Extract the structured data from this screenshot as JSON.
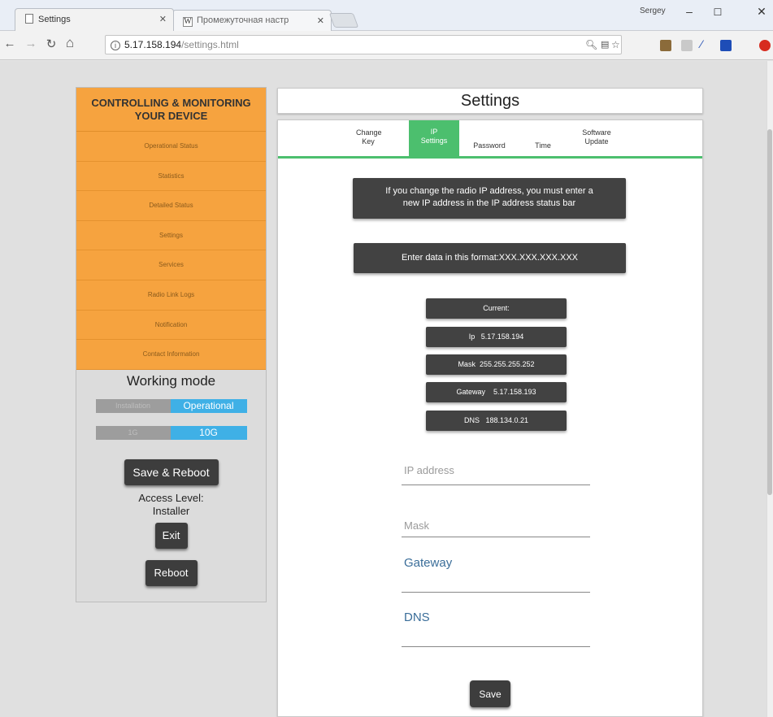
{
  "browser": {
    "tabs": [
      {
        "label": "Settings"
      },
      {
        "label": "Промежуточная настр"
      }
    ],
    "user": "Sergey",
    "url_host": "5.17.158.194",
    "url_path": "/settings.html"
  },
  "sidebar": {
    "header_line1": "CONTROLLING & MONITORING",
    "header_line2": "YOUR DEVICE",
    "items": [
      {
        "label": "Operational Status"
      },
      {
        "label": "Statistics"
      },
      {
        "label": "Detailed Status"
      },
      {
        "label": "Settings"
      },
      {
        "label": "Services"
      },
      {
        "label": "Radio Link Logs"
      },
      {
        "label": "Notification"
      },
      {
        "label": "Contact Information"
      }
    ],
    "working_mode_title": "Working mode",
    "mode_toggle": {
      "off_label": "Installation",
      "on_label": "Operational"
    },
    "speed_toggle": {
      "off_label": "1G",
      "on_label": "10G"
    },
    "save_reboot_label": "Save & Reboot",
    "access_level_label": "Access Level:",
    "access_level_value": "Installer",
    "exit_label": "Exit",
    "reboot_label": "Reboot"
  },
  "main": {
    "title": "Settings",
    "tabs": [
      {
        "line1": "Change",
        "line2": "Key"
      },
      {
        "line1": "IP",
        "line2": "Settings"
      },
      {
        "line1": "Password",
        "line2": ""
      },
      {
        "line1": "Time",
        "line2": ""
      },
      {
        "line1": "Software",
        "line2": "Update"
      }
    ],
    "active_tab": "IP Settings",
    "notice_line1": "If you change the radio IP address, you must enter a",
    "notice_line2": "new IP address in the IP address status bar",
    "format_hint": "Enter data in this format:XXX.XXX.XXX.XXX",
    "current": {
      "heading": "Current:",
      "ip_label": "Ip",
      "ip_value": "5.17.158.194",
      "mask_label": "Mask",
      "mask_value": "255.255.255.252",
      "gateway_label": "Gateway",
      "gateway_value": "5.17.158.193",
      "dns_label": "DNS",
      "dns_value": "188.134.0.21"
    },
    "fields": {
      "ip_placeholder": "IP address",
      "mask_placeholder": "Mask",
      "gateway_label": "Gateway",
      "dns_label": "DNS"
    },
    "save_label": "Save"
  },
  "colors": {
    "sidebar_orange": "#f6a33f",
    "active_tab_green": "#4cbf6e",
    "toggle_blue": "#3fb0e6",
    "dark_box": "#424242",
    "field_label_blue": "#3a6d99"
  }
}
